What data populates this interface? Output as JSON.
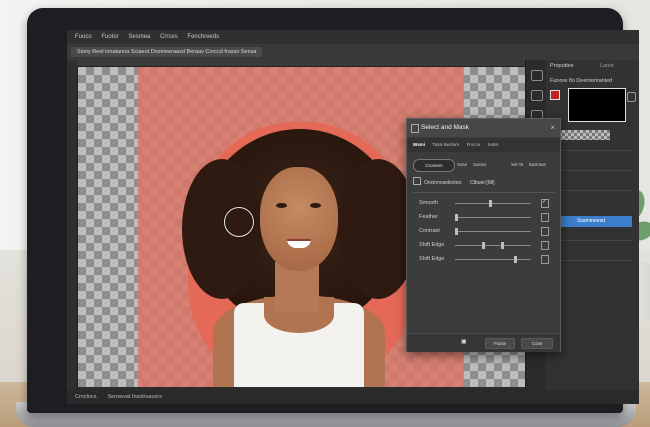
{
  "app": {
    "menu": [
      "Fuoco",
      "Fuotor",
      "Sesmea",
      "Crrces",
      "Fenchreeds"
    ],
    "options_tab": "Siony Reel innatanna Sciaeot Dosmeeraasd Beraav Corccd frasso Sensa",
    "status_left": "Crnclocs.",
    "status_mid": "Sensevat Insstruacers"
  },
  "layers_panel": {
    "tab_properties": "Proputtes",
    "tab_layer": "Lanot",
    "layer_label": "Funore flo Deententanled",
    "blue_button": "Ssammeead"
  },
  "dialog": {
    "title": "Select and Mask",
    "close": "×",
    "tabs": [
      "Wsmi",
      "Tassi Besfarn",
      "Frocce",
      "Sotet"
    ],
    "mode_button": "Crovrem",
    "mode_extras": [
      "Ssse",
      "Sasiss",
      "Sel Te",
      "Earmtue"
    ],
    "view_label": "Oncinnoselecton.",
    "view_value": "Ctbuer:[Ml]",
    "sliders": [
      {
        "label": "Smooth",
        "value": 0.45,
        "checked": true
      },
      {
        "label": "Feather",
        "value": 0.0,
        "checked": false
      },
      {
        "label": "Contrast",
        "value": 0.0,
        "checked": false
      },
      {
        "label": "Shift Edge",
        "value": 0.6,
        "checked": false
      },
      {
        "label": "Shift Edge",
        "value": 0.78,
        "checked": false
      }
    ],
    "footer_ok": "Fiuste",
    "footer_cancel": "Cose"
  },
  "colors": {
    "mask_overlay": "#dd7364",
    "accent_blue": "#3d7ecc",
    "panel_bg": "#323232"
  }
}
